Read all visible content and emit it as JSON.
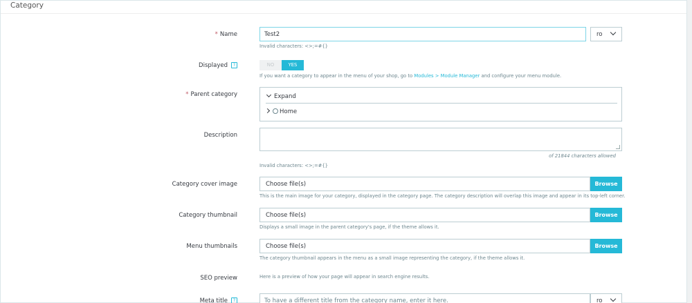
{
  "panel": {
    "title": "Category"
  },
  "name": {
    "label": "Name",
    "required": "*",
    "value": "Test2",
    "lang": "ro",
    "hint": "Invalid characters: <>;=#{}"
  },
  "displayed": {
    "label": "Displayed",
    "help": "?",
    "no": "NO",
    "yes": "YES",
    "hint_pre": "If you want a category to appear in the menu of your shop, go to ",
    "link_modules": "Modules",
    "sep": " > ",
    "link_manager": "Module Manager",
    "hint_post": " and configure your menu module."
  },
  "parent": {
    "label": "Parent category",
    "required": "*",
    "expand": "Expand",
    "home": "Home"
  },
  "description": {
    "label": "Description",
    "counter": "of 21844 characters allowed",
    "hint": "Invalid characters: <>;=#{}"
  },
  "cover": {
    "label": "Category cover image",
    "value": "Choose file(s)",
    "browse": "Browse",
    "hint": "This is the main image for your category, displayed in the category page. The category description will overlap this image and appear in its top-left corner."
  },
  "thumb": {
    "label": "Category thumbnail",
    "value": "Choose file(s)",
    "browse": "Browse",
    "hint": "Displays a small image in the parent category's page, if the theme allows it."
  },
  "menu": {
    "label": "Menu thumbnails",
    "value": "Choose file(s)",
    "browse": "Browse",
    "hint": "The category thumbnail appears in the menu as a small image representing the category, if the theme allows it."
  },
  "seo": {
    "label": "SEO preview",
    "hint": "Here is a preview of how your page will appear in search engine results."
  },
  "meta": {
    "label": "Meta title",
    "help": "?",
    "placeholder": "To have a different title from the category name, enter it here.",
    "lang": "ro"
  },
  "colors": {
    "accent": "#25b9d7",
    "required": "#c05c67",
    "border": "#bbcdd2",
    "muted": "#6c868e"
  }
}
